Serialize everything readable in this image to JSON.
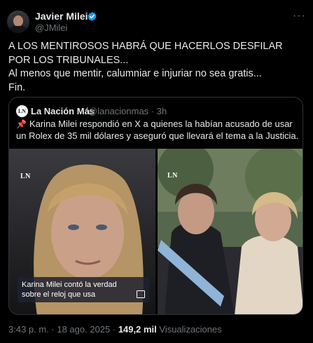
{
  "author": {
    "name": "Javier Milei",
    "handle": "@JMilei"
  },
  "tweet": {
    "lines": [
      "A LOS MENTIROSOS HABRÁ QUE HACERLOS DESFILAR POR LOS TRIBUNALES...",
      "Al menos que mentir, calumniar e injuriar no sea gratis...",
      "Fin."
    ]
  },
  "quote": {
    "logo_text": "LN",
    "author_name": "La Nación Más",
    "author_handle": "@lanacionmas · 3h",
    "text": "Karina Milei respondió en X a quienes la habían acusado de usar un Rolex de 35 mil dólares y aseguró que llevará el tema a la Justicia.",
    "images": [
      {
        "watermark": "LN",
        "caption": "Karina Milei contó la verdad sobre el reloj que usa"
      },
      {
        "watermark": "LN"
      }
    ]
  },
  "footer": {
    "time": "3:43 p. m. · 18 ago. 2025 · ",
    "views": "149,2 mil",
    "views_label": " Visualizaciones"
  },
  "icons": {
    "verified": "verified-badge-icon",
    "more": "more-options-icon",
    "pin": "pushpin-icon",
    "expand": "expand-image-icon"
  },
  "colors": {
    "background": "#000000",
    "text": "#e7e9ea",
    "muted": "#71767b",
    "verified": "#1d9bf0",
    "border": "#2f3336"
  }
}
